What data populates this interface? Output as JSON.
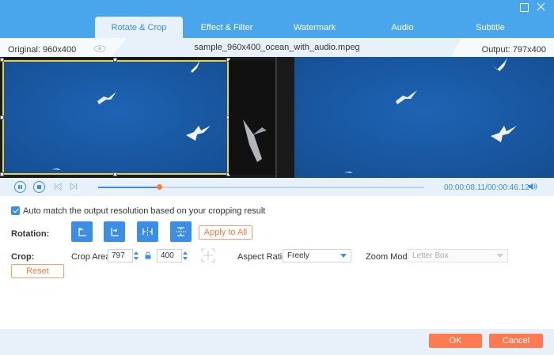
{
  "tabs": [
    {
      "label": "Rotate & Crop",
      "active": true
    },
    {
      "label": "Effect & Filter",
      "active": false
    },
    {
      "label": "Watermark",
      "active": false
    },
    {
      "label": "Audio",
      "active": false
    },
    {
      "label": "Subtitle",
      "active": false
    }
  ],
  "info": {
    "original": "Original: 960x400",
    "filename": "sample_960x400_ocean_with_audio.mpeg",
    "output": "Output: 797x400"
  },
  "playback": {
    "current_time": "00:00:08.11",
    "total_time": "/00:00:46.12",
    "progress": 0.187
  },
  "settings": {
    "auto_match_label": "Auto match the output resolution based on your cropping result",
    "auto_match_checked": true,
    "rotation_label": "Rotation:",
    "apply_all_label": "Apply to All",
    "crop_label": "Crop:",
    "crop_area_label": "Crop Area:",
    "crop_width": "797",
    "crop_height": "400",
    "aspect_ratio_label": "Aspect Ratio:",
    "aspect_ratio_value": "Freely",
    "zoom_mode_label": "Zoom Mode:",
    "zoom_mode_value": "Letter Box",
    "reset_label": "Reset"
  },
  "footer": {
    "ok_label": "OK",
    "cancel_label": "Cancel"
  },
  "colors": {
    "accent": "#3a8ee6",
    "titlebar": "#4aa6ec",
    "orange": "#ff7a50",
    "video_blue": "#1a5aa6",
    "crop_frame": "#e2d44a"
  }
}
